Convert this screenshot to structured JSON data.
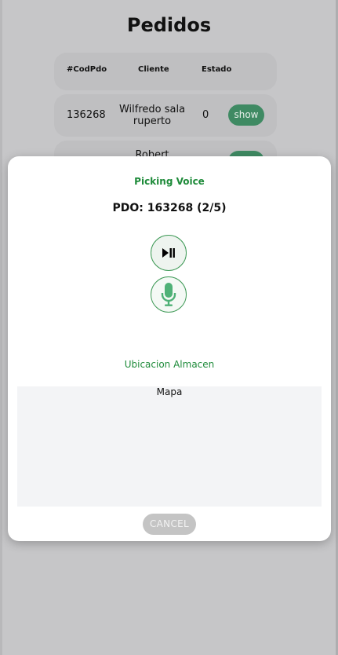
{
  "page": {
    "title": "Pedidos"
  },
  "table": {
    "headers": [
      "#CodPdo",
      "Cliente",
      "Estado"
    ],
    "rows": [
      {
        "cod": "136268",
        "client_line1": "Wilfredo sala",
        "client_line2": "ruperto",
        "status": "0",
        "action": "show"
      },
      {
        "cod": "",
        "client_line1": "Robert",
        "client_line2": "",
        "status": "",
        "action": "show"
      }
    ]
  },
  "modal": {
    "title": "Picking Voice",
    "pdo": "PDO: 163268 (2/5)",
    "play_icon": "play-pause-icon",
    "mic_icon": "microphone-icon",
    "location_title": "Ubicacion Almacen",
    "map_label": "Mapa",
    "cancel_label": "CANCEL"
  },
  "colors": {
    "accent_green": "#1e8b3a",
    "show_button": "#3f8a63",
    "overlay": "#c6c6c8"
  }
}
